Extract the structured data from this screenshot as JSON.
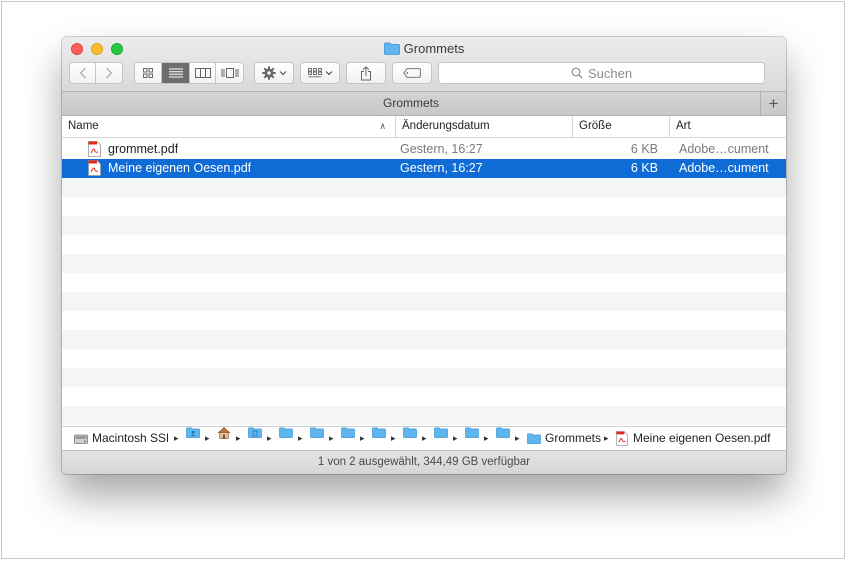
{
  "window": {
    "title": "Grommets"
  },
  "toolbar": {
    "back_icon": "chevron-left-icon",
    "forward_icon": "chevron-right-icon",
    "view_modes": [
      "icon-view-icon",
      "list-view-icon",
      "column-view-icon",
      "cover-flow-icon"
    ],
    "selected_view": "list-view-icon",
    "action_icon": "gear-icon",
    "arrange_icon": "arrange-grid-icon",
    "share_icon": "share-icon",
    "tags_icon": "tag-icon",
    "search_placeholder": "Suchen"
  },
  "tabbar": {
    "title": "Grommets",
    "add_label": "+"
  },
  "columns": {
    "name": "Name",
    "date": "Änderungsdatum",
    "size": "Größe",
    "kind": "Art"
  },
  "files": [
    {
      "name": "grommet.pdf",
      "date": "Gestern, 16:27",
      "size": "6 KB",
      "kind": "Adobe…cument",
      "selected": false
    },
    {
      "name": "Meine eigenen Oesen.pdf",
      "date": "Gestern, 16:27",
      "size": "6 KB",
      "kind": "Adobe…cument",
      "selected": true
    }
  ],
  "pathbar": {
    "disk": "Macintosh SSD",
    "folder": "Grommets",
    "file": "Meine eigenen Oesen.pdf"
  },
  "status": "1 von 2 ausgewählt, 344,49 GB verfügbar",
  "colors": {
    "selection": "#0f6bd6",
    "folder": "#5fb5ee",
    "close": "#fc5f57",
    "minimize": "#fdbc2e",
    "zoom": "#28c840"
  }
}
